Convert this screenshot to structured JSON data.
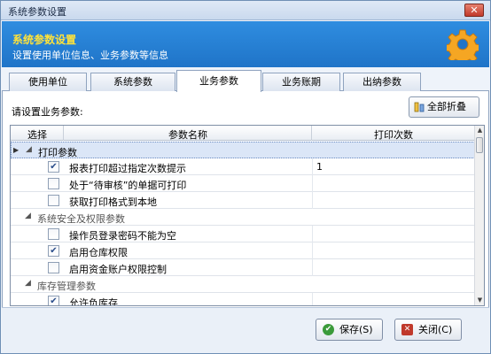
{
  "window": {
    "title": "系统参数设置",
    "close_glyph": "✕"
  },
  "banner": {
    "title": "系统参数设置",
    "description": "设置使用单位信息、业务参数等信息",
    "icon": "gear-icon"
  },
  "tabs": [
    {
      "label": "使用单位",
      "active": false
    },
    {
      "label": "系统参数",
      "active": false
    },
    {
      "label": "业务参数",
      "active": true
    },
    {
      "label": "业务账期",
      "active": false
    },
    {
      "label": "出纳参数",
      "active": false
    }
  ],
  "panel": {
    "prompt": "请设置业务参数:",
    "collapse_button": "全部折叠"
  },
  "grid": {
    "columns": [
      "选择",
      "参数名称",
      "打印次数"
    ],
    "rows": [
      {
        "type": "group",
        "label": "打印参数",
        "selected": true
      },
      {
        "type": "item",
        "label": "报表打印超过指定次数提示",
        "checked": true,
        "value": "1"
      },
      {
        "type": "item",
        "label": "处于“待审核”的单据可打印",
        "checked": false,
        "value": ""
      },
      {
        "type": "item",
        "label": "获取打印格式到本地",
        "checked": false,
        "value": ""
      },
      {
        "type": "group",
        "label": "系统安全及权限参数",
        "selected": false
      },
      {
        "type": "item",
        "label": "操作员登录密码不能为空",
        "checked": false,
        "value": ""
      },
      {
        "type": "item",
        "label": "启用仓库权限",
        "checked": true,
        "value": ""
      },
      {
        "type": "item",
        "label": "启用资金账户权限控制",
        "checked": false,
        "value": ""
      },
      {
        "type": "group",
        "label": "库存管理参数",
        "selected": false
      },
      {
        "type": "item",
        "label": "允许负库存",
        "checked": true,
        "value": ""
      }
    ],
    "row_indicator": "▶",
    "expander_glyph": "◢",
    "check_glyph": "✔",
    "scroll_up": "▲",
    "scroll_down": "▼"
  },
  "footer": {
    "save_label": "保存(S)",
    "close_label": "关闭(C)",
    "save_icon_color": "#3a9a3a",
    "close_icon_color": "#c0392b"
  },
  "colors": {
    "banner": "#2f8de0",
    "banner_title": "#ffe23a",
    "selected_row": "#dbe6f7"
  }
}
